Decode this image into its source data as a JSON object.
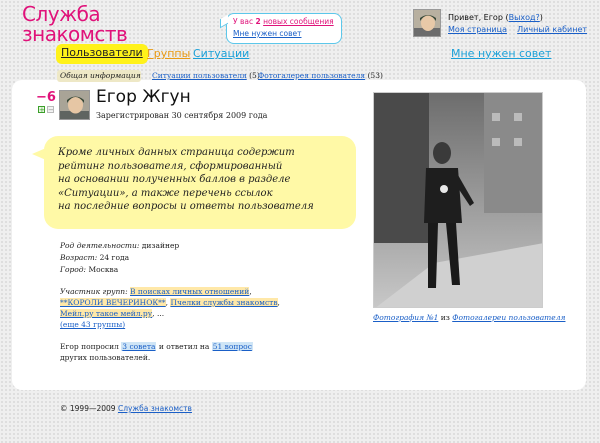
{
  "logo": {
    "line1": "Служба",
    "line2": "знакомств"
  },
  "notification": {
    "prefix": "У вас",
    "count": "2",
    "messages_link": "новых сообщения",
    "advice_link": "Мне нужен совет"
  },
  "user": {
    "greeting": "Привет, Егор",
    "logout": "Выход?",
    "my_page": "Моя страница",
    "cabinet": "Личный кабинет"
  },
  "nav": {
    "users": "Пользователи",
    "groups": "Группы",
    "situations": "Ситуации",
    "need_advice": "Мне нужен совет"
  },
  "subtabs": {
    "general": "Общая информация",
    "situations": "Ситуации пользователя",
    "situations_count": "(5)",
    "gallery": "Фотогалерея пользователя",
    "gallery_count": "(53)"
  },
  "profile": {
    "rating": "−6",
    "plus": "+",
    "minus": "−",
    "name": "Егор Жгун",
    "registered": "Зарегистрирован 30 сентября 2009 года"
  },
  "hint": {
    "lines": [
      "Кроме личных данных страница содержит",
      "рейтинг пользователя, сформированный",
      "на основании полученных баллов в разделе",
      "«Ситуации», а также перечень ссылок",
      "на последние вопросы и ответы пользователя"
    ]
  },
  "info": {
    "occupation_label": "Род деятельности:",
    "occupation_value": "дизайнер",
    "age_label": "Возраст:",
    "age_value": "24 года",
    "city_label": "Город:",
    "city_value": "Москва"
  },
  "groups": {
    "label": "Участник групп:",
    "items": [
      "В поисках личных отношений",
      "**КОРОЛИ ВЕЧЕРИНОК**",
      "Пчелки службы знакомств",
      "Мейл.ру такое мейл.ру"
    ],
    "sep": ",",
    "ellipsis": "...",
    "more": "(еще 43 группы)"
  },
  "stats": {
    "prefix": "Егор попросил",
    "advice": "3 совета",
    "middle": "и ответил на",
    "questions": "51 вопрос",
    "suffix": "других пользователей."
  },
  "photo_caption": {
    "photo_link": "Фотография №1",
    "from": "из",
    "gallery_link": "Фотогалереи пользователя"
  },
  "footer": {
    "copyright": "© 1999—2009",
    "link": "Служба знакомств"
  },
  "colors": {
    "accent_pink": "#e0127a",
    "link_blue": "#1a5fc7",
    "nav_yellow": "#fff21a",
    "hint_bg": "#fff9a6"
  }
}
